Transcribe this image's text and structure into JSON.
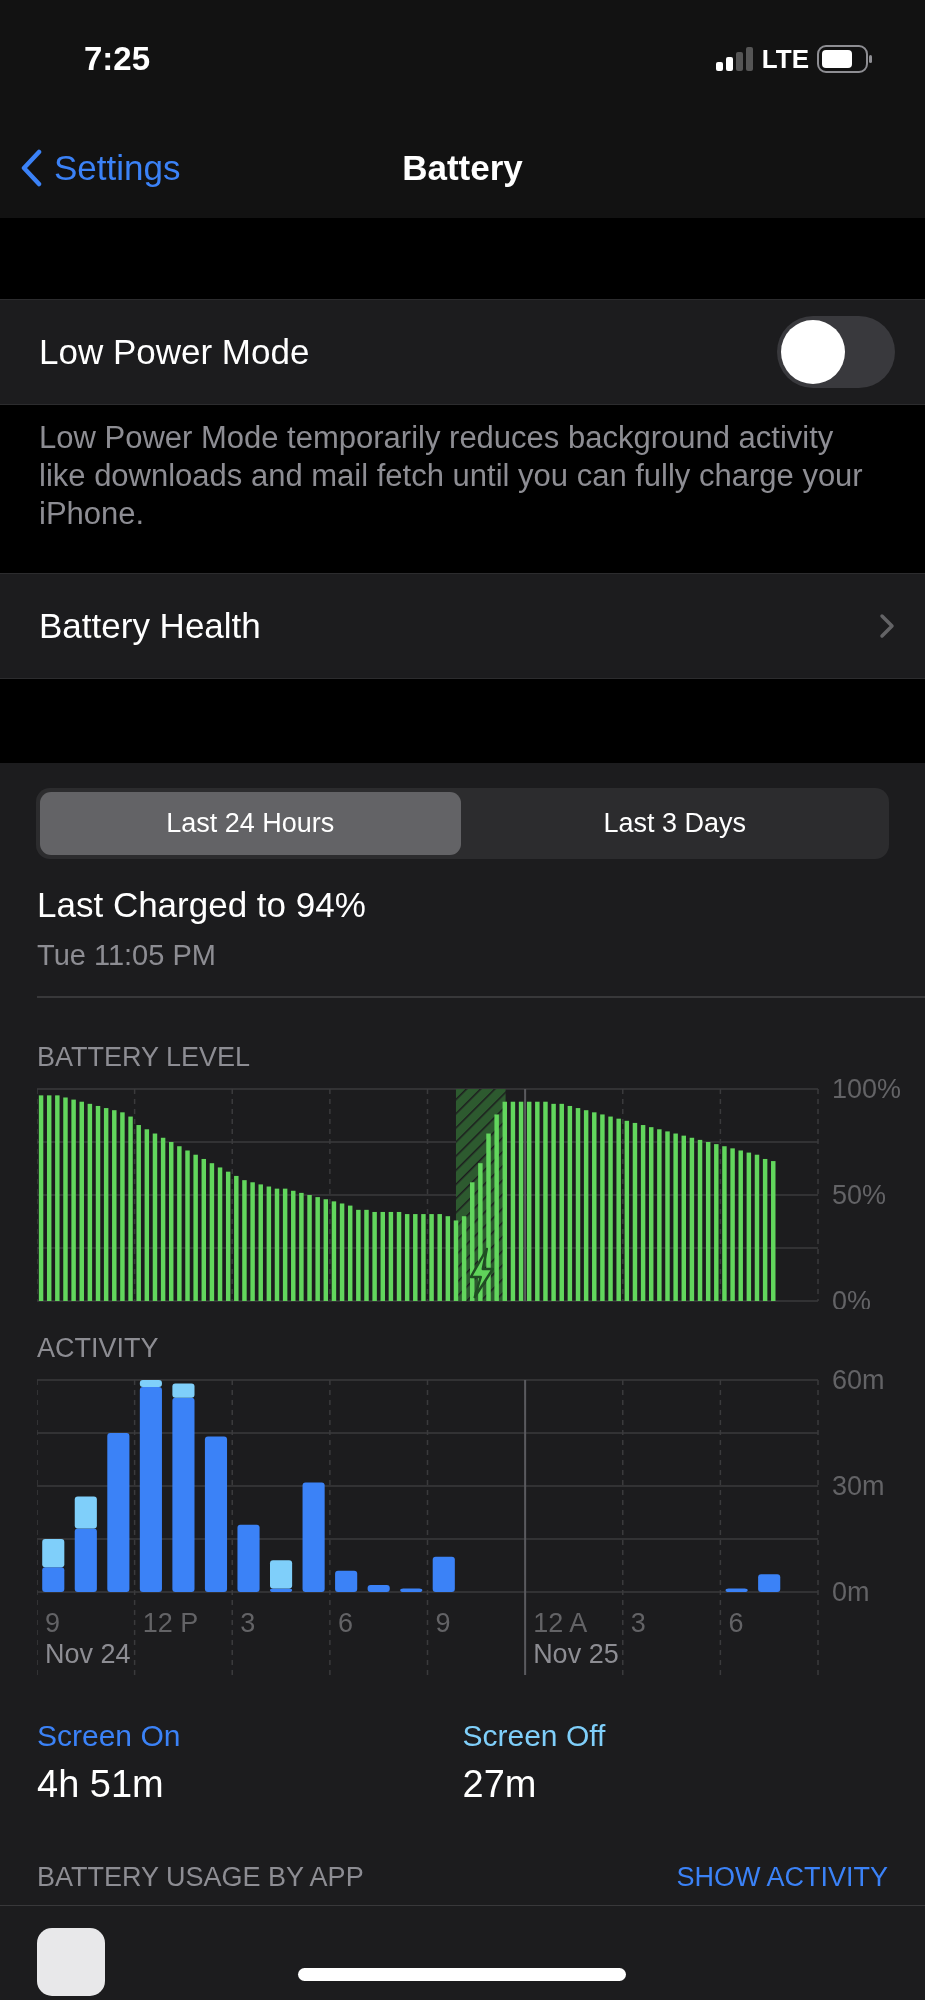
{
  "status_bar": {
    "time": "7:25",
    "network": "LTE"
  },
  "nav": {
    "back": "Settings",
    "title": "Battery"
  },
  "low_power": {
    "label": "Low Power Mode",
    "on": false,
    "footer": "Low Power Mode temporarily reduces background activity like downloads and mail fetch until you can fully charge your iPhone."
  },
  "battery_health": {
    "label": "Battery Health"
  },
  "segments": [
    {
      "label": "Last 24 Hours",
      "selected": true
    },
    {
      "label": "Last 3 Days",
      "selected": false
    }
  ],
  "last_charged": {
    "title": "Last Charged to 94%",
    "time": "Tue 11:05 PM"
  },
  "battery_level": {
    "label": "BATTERY LEVEL",
    "chart_data": {
      "type": "bar",
      "grid": true,
      "ylim": [
        0,
        100
      ],
      "yticks": [
        {
          "value": 0,
          "label": "0%"
        },
        {
          "value": 50,
          "label": "50%"
        },
        {
          "value": 100,
          "label": "100%"
        }
      ],
      "values": [
        97,
        97,
        97,
        96,
        95,
        94,
        93,
        92,
        91,
        90,
        89,
        87,
        83,
        81,
        79,
        77,
        75,
        73,
        71,
        69,
        67,
        65,
        63,
        61,
        59,
        57,
        56,
        55,
        54,
        53,
        53,
        52,
        51,
        50,
        49,
        48,
        47,
        46,
        45,
        43,
        43,
        42,
        42,
        42,
        42,
        41,
        41,
        41,
        41,
        41,
        40,
        38,
        40,
        56,
        65,
        79,
        88,
        94,
        94,
        94,
        94,
        94,
        94,
        93,
        93,
        92,
        91,
        90,
        89,
        88,
        87,
        86,
        85,
        84,
        83,
        82,
        81,
        80,
        79,
        78,
        77,
        76,
        75,
        74,
        73,
        72,
        71,
        70,
        69,
        67,
        66,
        null,
        null,
        null,
        null,
        null
      ]
    }
  },
  "activity": {
    "label": "ACTIVITY",
    "chart_data": {
      "type": "bar",
      "stacked": true,
      "grid": true,
      "ylim": [
        0,
        60
      ],
      "yticks": [
        {
          "value": 0,
          "label": "0m"
        },
        {
          "value": 30,
          "label": "30m"
        },
        {
          "value": 60,
          "label": "60m"
        }
      ],
      "series": [
        {
          "name": "Screen On",
          "color": "#3b82f7",
          "values": [
            7,
            18,
            45,
            58,
            55,
            44,
            19,
            1,
            31,
            6,
            2,
            1,
            10,
            null,
            null,
            null,
            null,
            null,
            null,
            null,
            null,
            1,
            5,
            null
          ]
        },
        {
          "name": "Screen Off",
          "color": "#7fcffa",
          "values": [
            8,
            9,
            0,
            2,
            4,
            0,
            0,
            8,
            0,
            0,
            0,
            0,
            0,
            null,
            null,
            null,
            null,
            null,
            null,
            null,
            null,
            0,
            0,
            null
          ]
        }
      ]
    },
    "time_labels": [
      {
        "label": "9",
        "date": "Nov 24"
      },
      {
        "label": "12 P"
      },
      {
        "label": "3"
      },
      {
        "label": "6"
      },
      {
        "label": "9"
      },
      {
        "label": "12 A",
        "date": "Nov 25"
      },
      {
        "label": "3"
      },
      {
        "label": "6"
      }
    ]
  },
  "totals": [
    {
      "value": "4h 51m"
    },
    {
      "value": "27m"
    }
  ],
  "usage": {
    "label": "BATTERY USAGE BY APP",
    "action": "SHOW ACTIVITY"
  }
}
